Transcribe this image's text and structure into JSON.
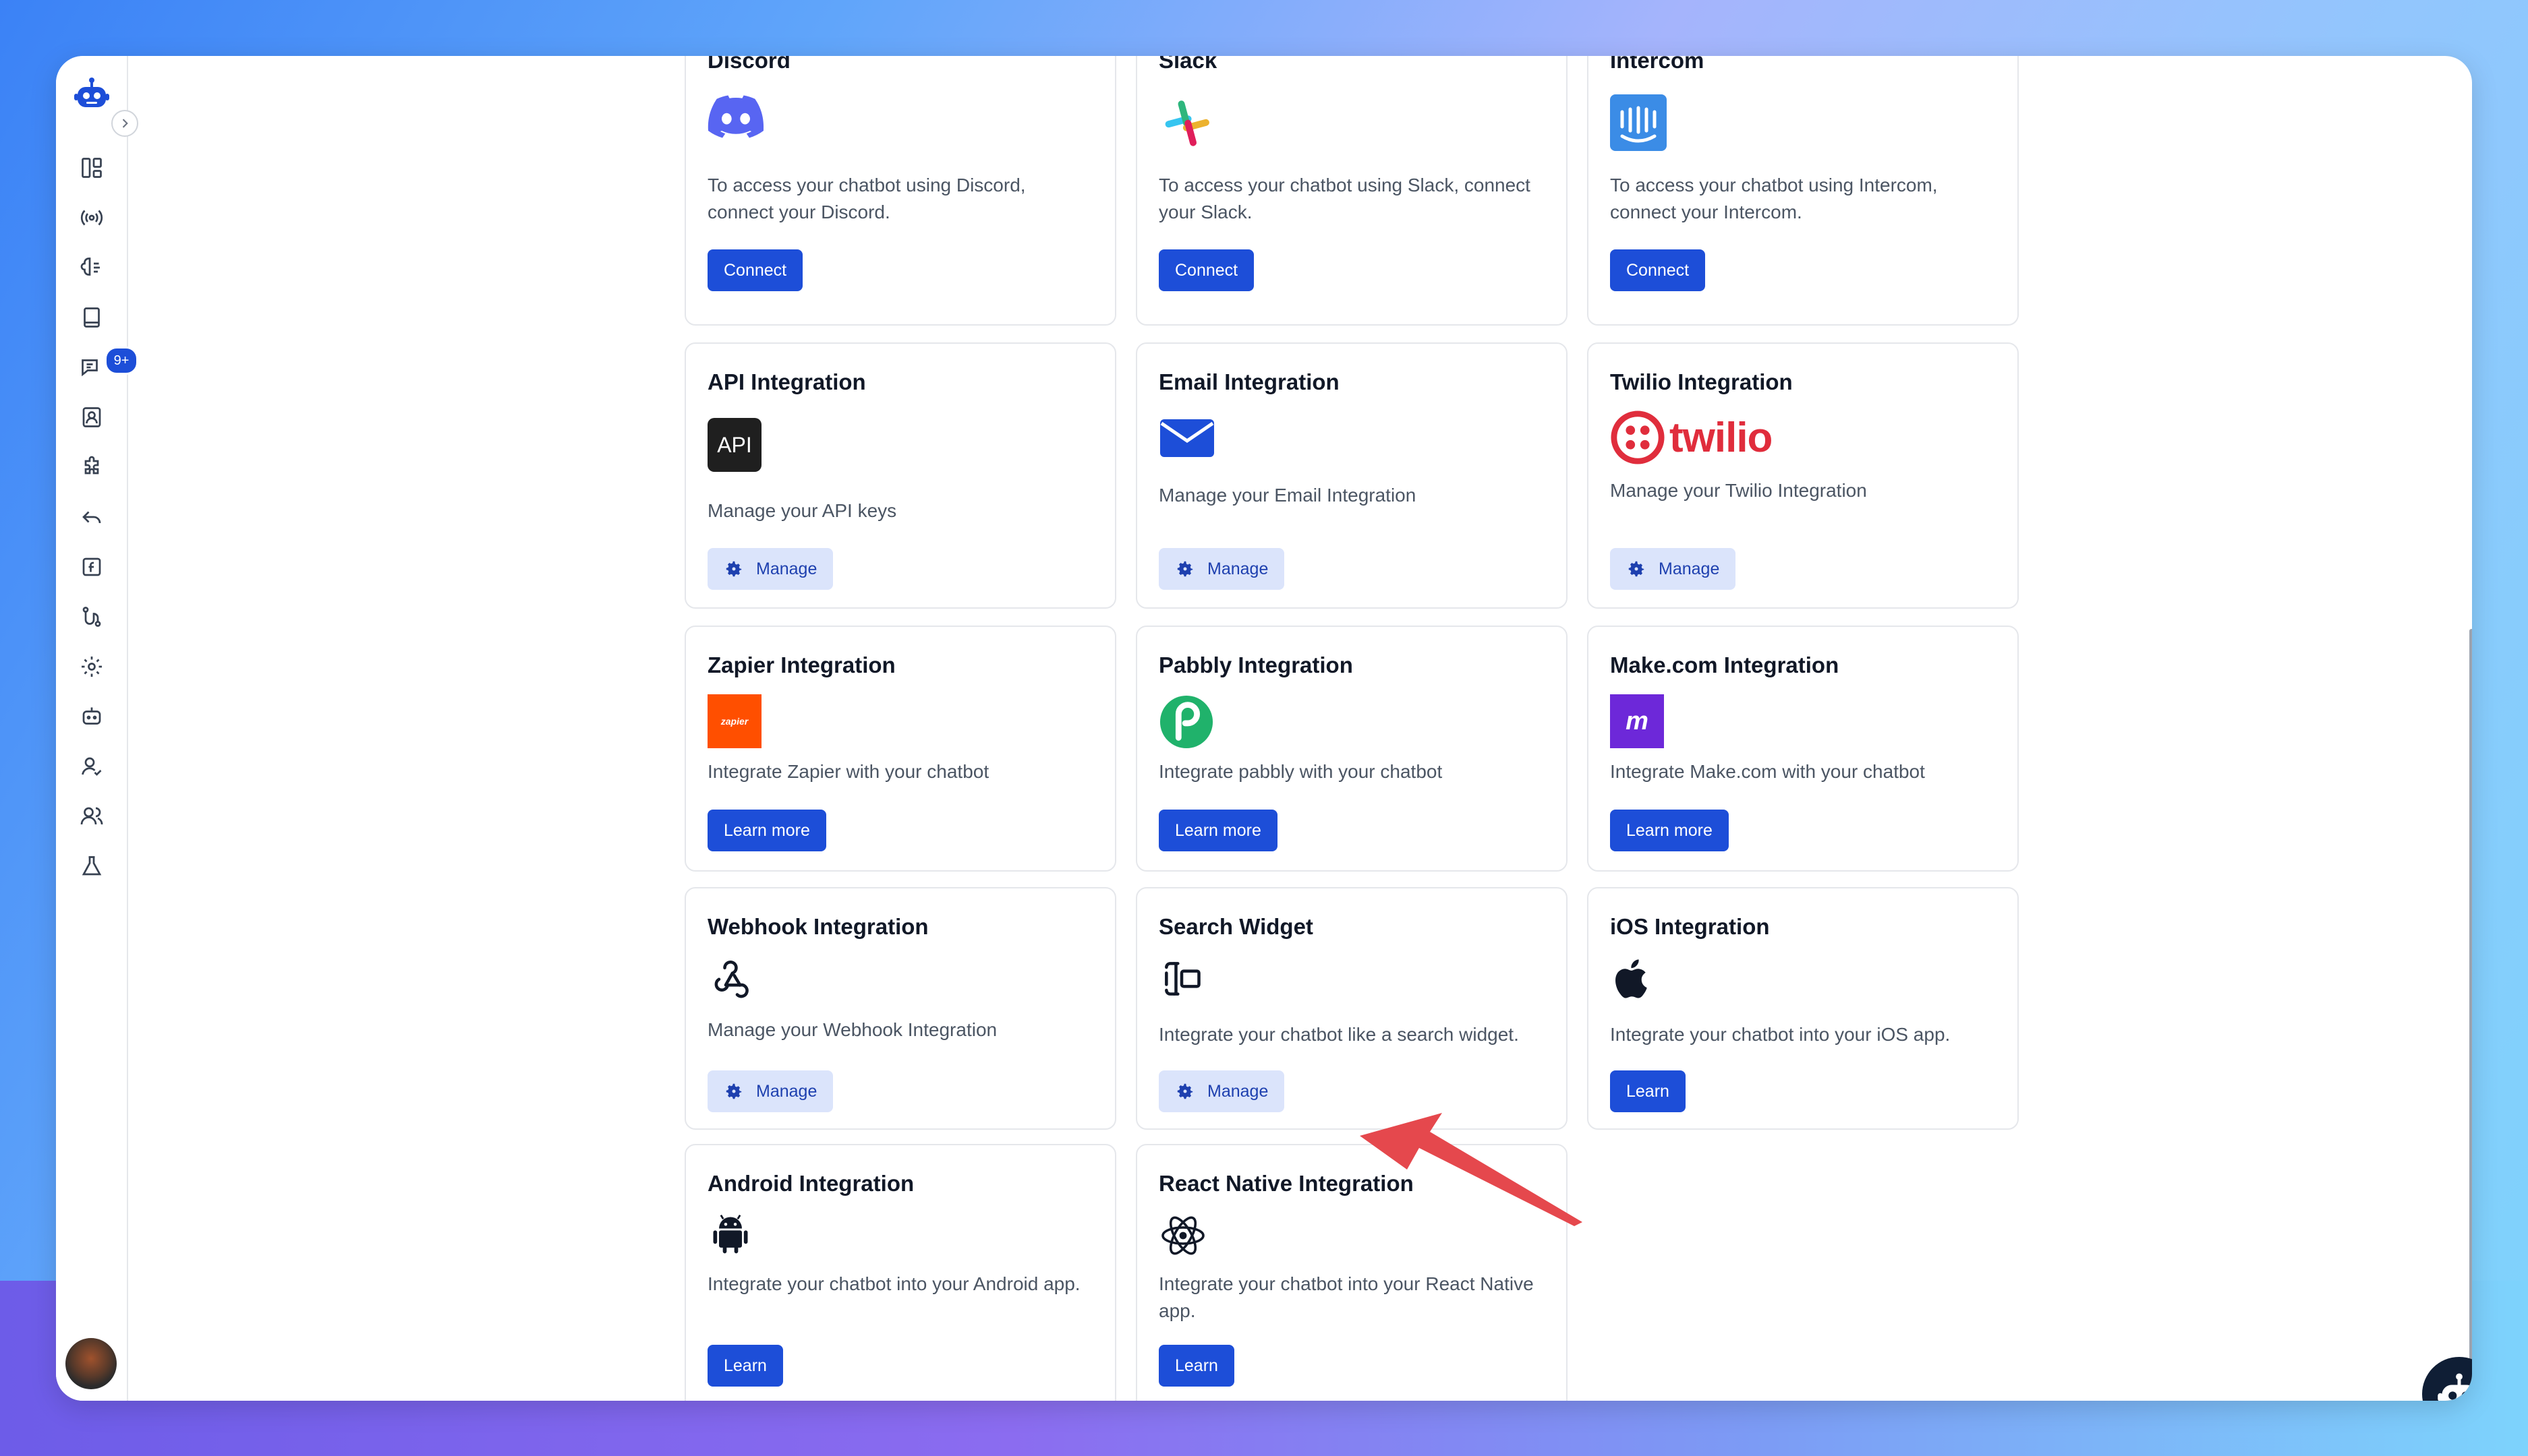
{
  "sidebar": {
    "logo_icon": "robot-icon",
    "notification_badge": "9+",
    "items": [
      {
        "name": "dashboard-icon"
      },
      {
        "name": "broadcast-icon"
      },
      {
        "name": "brain-icon"
      },
      {
        "name": "book-icon"
      },
      {
        "name": "chat-icon"
      },
      {
        "name": "contacts-icon"
      },
      {
        "name": "puzzle-icon"
      },
      {
        "name": "reply-icon"
      },
      {
        "name": "function-icon"
      },
      {
        "name": "flow-icon"
      },
      {
        "name": "gear-icon"
      },
      {
        "name": "bot-icon"
      },
      {
        "name": "user-check-icon"
      },
      {
        "name": "users-icon"
      },
      {
        "name": "flask-icon"
      }
    ]
  },
  "cards": {
    "discord": {
      "title": "Discord",
      "desc": "To access your chatbot using Discord, connect your Discord.",
      "button": "Connect"
    },
    "slack": {
      "title": "Slack",
      "desc": "To access your chatbot using Slack, connect your Slack.",
      "button": "Connect"
    },
    "intercom": {
      "title": "Intercom",
      "desc": "To access your chatbot using Intercom, connect your Intercom.",
      "button": "Connect"
    },
    "api": {
      "title": "API Integration",
      "icon_text": "API",
      "desc": "Manage your API keys",
      "button": "Manage"
    },
    "email": {
      "title": "Email Integration",
      "desc": "Manage your Email Integration",
      "button": "Manage"
    },
    "twilio": {
      "title": "Twilio Integration",
      "logo_text": "twilio",
      "desc": "Manage your Twilio Integration",
      "button": "Manage"
    },
    "zapier": {
      "title": "Zapier Integration",
      "icon_text": "zapier",
      "desc": "Integrate Zapier with your chatbot",
      "button": "Learn more"
    },
    "pabbly": {
      "title": "Pabbly Integration",
      "desc": "Integrate pabbly with your chatbot",
      "button": "Learn more"
    },
    "make": {
      "title": "Make.com Integration",
      "icon_text": "m",
      "desc": "Integrate Make.com with your chatbot",
      "button": "Learn more"
    },
    "webhook": {
      "title": "Webhook Integration",
      "desc": "Manage your Webhook Integration",
      "button": "Manage"
    },
    "search_widget": {
      "title": "Search Widget",
      "desc": "Integrate your chatbot like a search widget.",
      "button": "Manage"
    },
    "ios": {
      "title": "iOS Integration",
      "desc": "Integrate your chatbot into your iOS app.",
      "button": "Learn"
    },
    "android": {
      "title": "Android Integration",
      "desc": "Integrate your chatbot into your Android app.",
      "button": "Learn"
    },
    "react_native": {
      "title": "React Native Integration",
      "desc": "Integrate your chatbot into your React Native app.",
      "button": "Learn"
    }
  },
  "colors": {
    "primary": "#1d4ed8",
    "manage_bg": "#dbe4fb",
    "arrow": "#e5484d",
    "twilio": "#e02d3c",
    "zapier": "#ff4f00",
    "make": "#6d28d9",
    "discord": "#5865f2",
    "intercom": "#3b8ce6",
    "pabbly": "#20b26b"
  }
}
